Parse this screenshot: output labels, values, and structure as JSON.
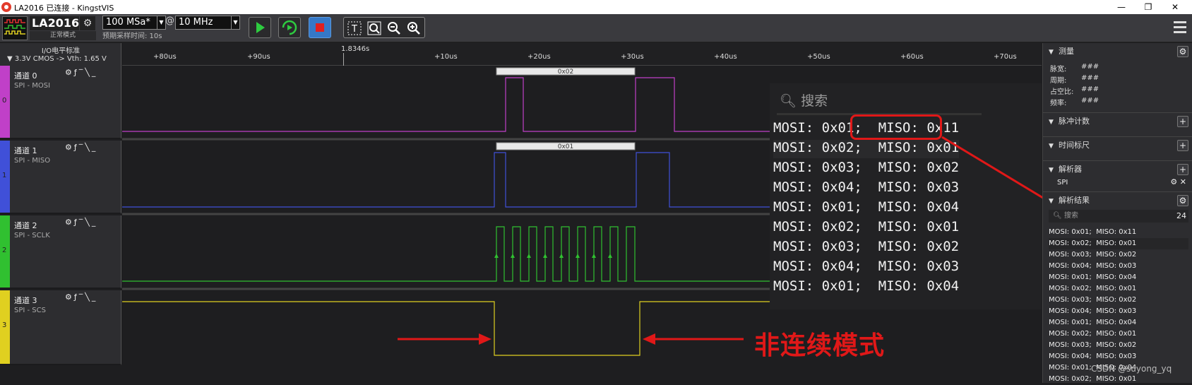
{
  "window": {
    "title": "LA2016 已连接 - KingstVIS",
    "minimize": "—",
    "maximize": "❐",
    "close": "✕"
  },
  "toolbar": {
    "device_name": "LA2016",
    "device_mode": "正常模式",
    "sample_rate": "100 MSa*",
    "at": "@",
    "sample_depth": "10 MHz",
    "pre_time": "预期采样时间: 10s",
    "colors": {
      "run": "#2ecc40",
      "stop": "#e02020",
      "stop_bg": "#3578c8"
    }
  },
  "io": {
    "title": "I/O电平标准",
    "standard": "▼  3.3V CMOS  -> Vth: 1.65 V"
  },
  "ruler": {
    "cursor_label": "1.8346s",
    "ticks": [
      "+80us",
      "+90us",
      "|",
      "+10us",
      "+20us",
      "+30us",
      "+40us",
      "+50us",
      "+60us",
      "+70us"
    ]
  },
  "channels": [
    {
      "num": "0",
      "name": "通道 0",
      "proto": "SPI - MOSI",
      "color": "#c040c8",
      "decode": "0x02"
    },
    {
      "num": "1",
      "name": "通道 1",
      "proto": "SPI - MISO",
      "color": "#4050d8",
      "decode": "0x01"
    },
    {
      "num": "2",
      "name": "通道 2",
      "proto": "SPI - SCLK",
      "color": "#30c030"
    },
    {
      "num": "3",
      "name": "通道 3",
      "proto": "SPI - SCS",
      "color": "#e0d020"
    }
  ],
  "channel_ctrl": "⚙ƒ‾╲_",
  "zoom": {
    "search_placeholder": "搜索",
    "rows": [
      "MOSI: 0x01;  MISO: 0x11",
      "MOSI: 0x02;  MISO: 0x01",
      "MOSI: 0x03;  MISO: 0x02",
      "MOSI: 0x04;  MISO: 0x03",
      "MOSI: 0x01;  MISO: 0x04",
      "MOSI: 0x02;  MISO: 0x01",
      "MOSI: 0x03;  MISO: 0x02",
      "MOSI: 0x04;  MISO: 0x03",
      "MOSI: 0x01;  MISO: 0x04"
    ]
  },
  "annotation": {
    "text": "非连续模式",
    "color": "#e01818"
  },
  "panel": {
    "measure": {
      "title": "测量",
      "rows": [
        {
          "k": "脉宽:",
          "v": "###"
        },
        {
          "k": "周期:",
          "v": "###"
        },
        {
          "k": "占空比:",
          "v": "###"
        },
        {
          "k": "频率:",
          "v": "###"
        }
      ]
    },
    "pulse_count": "脉冲计数",
    "time_ruler": "时间标尺",
    "analyzer": {
      "title": "解析器",
      "item": "SPI"
    },
    "results": {
      "title": "解析结果",
      "search_placeholder": "搜索",
      "count": "24",
      "rows": [
        "MOSI: 0x01;  MISO: 0x11",
        "MOSI: 0x02;  MISO: 0x01",
        "MOSI: 0x03;  MISO: 0x02",
        "MOSI: 0x04;  MISO: 0x03",
        "MOSI: 0x01;  MISO: 0x04",
        "MOSI: 0x02;  MISO: 0x01",
        "MOSI: 0x03;  MISO: 0x02",
        "MOSI: 0x04;  MISO: 0x03",
        "MOSI: 0x01;  MISO: 0x04",
        "MOSI: 0x02;  MISO: 0x01",
        "MOSI: 0x03;  MISO: 0x02",
        "MOSI: 0x04;  MISO: 0x03",
        "MOSI: 0x01;  MISO: 0x04",
        "MOSI: 0x02;  MISO: 0x01"
      ]
    }
  },
  "watermark": "CSDN @suyong_yq"
}
